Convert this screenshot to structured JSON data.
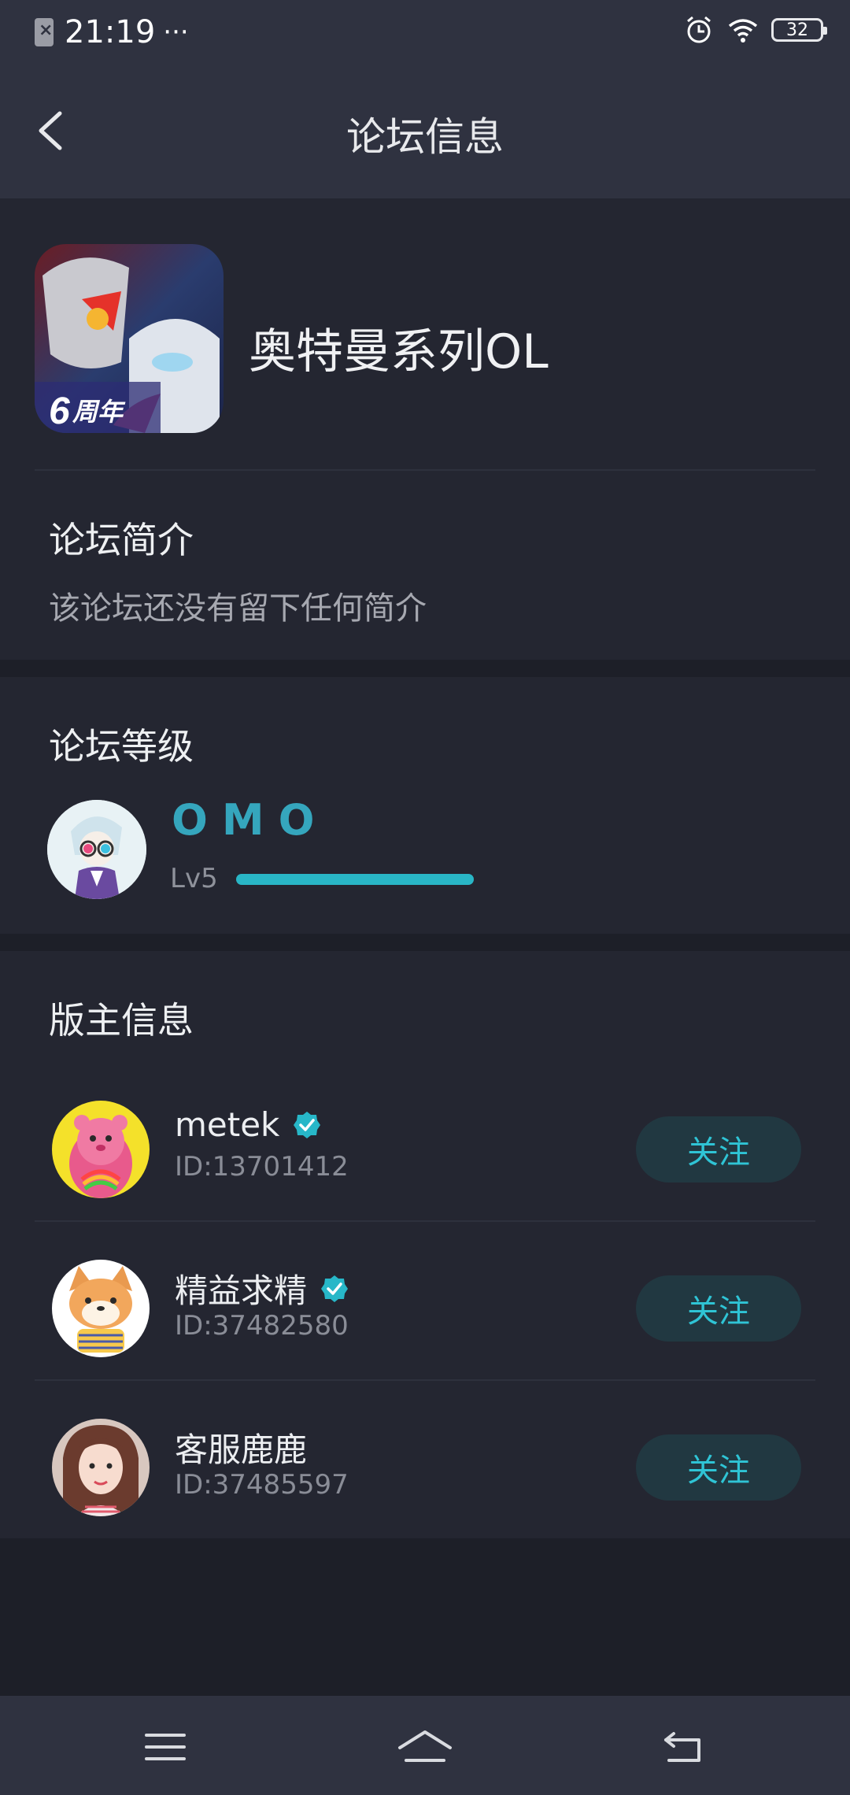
{
  "status_bar": {
    "time": "21:19",
    "dots": "···",
    "battery": "32"
  },
  "header": {
    "title": "论坛信息"
  },
  "forum": {
    "name": "奥特曼系列OL",
    "intro_title": "论坛简介",
    "intro_text": "该论坛还没有留下任何简介"
  },
  "level": {
    "title": "论坛等级",
    "brand": "OMO",
    "level_label": "Lv5",
    "progress": 1.0
  },
  "moderators": {
    "title": "版主信息",
    "items": [
      {
        "name": "metek",
        "id": "ID:13701412",
        "verified": true,
        "follow_label": "关注",
        "avatar": "care-bear-avatar"
      },
      {
        "name": "精益求精",
        "id": "ID:37482580",
        "verified": true,
        "follow_label": "关注",
        "avatar": "shiba-dog-avatar"
      },
      {
        "name": "客服鹿鹿",
        "id": "ID:37485597",
        "verified": false,
        "follow_label": "关注",
        "avatar": "girl-photo-avatar"
      }
    ]
  },
  "colors": {
    "accent": "#2fc4d5",
    "background": "#1d1f28",
    "card": "#242631",
    "header": "#2f3240"
  }
}
